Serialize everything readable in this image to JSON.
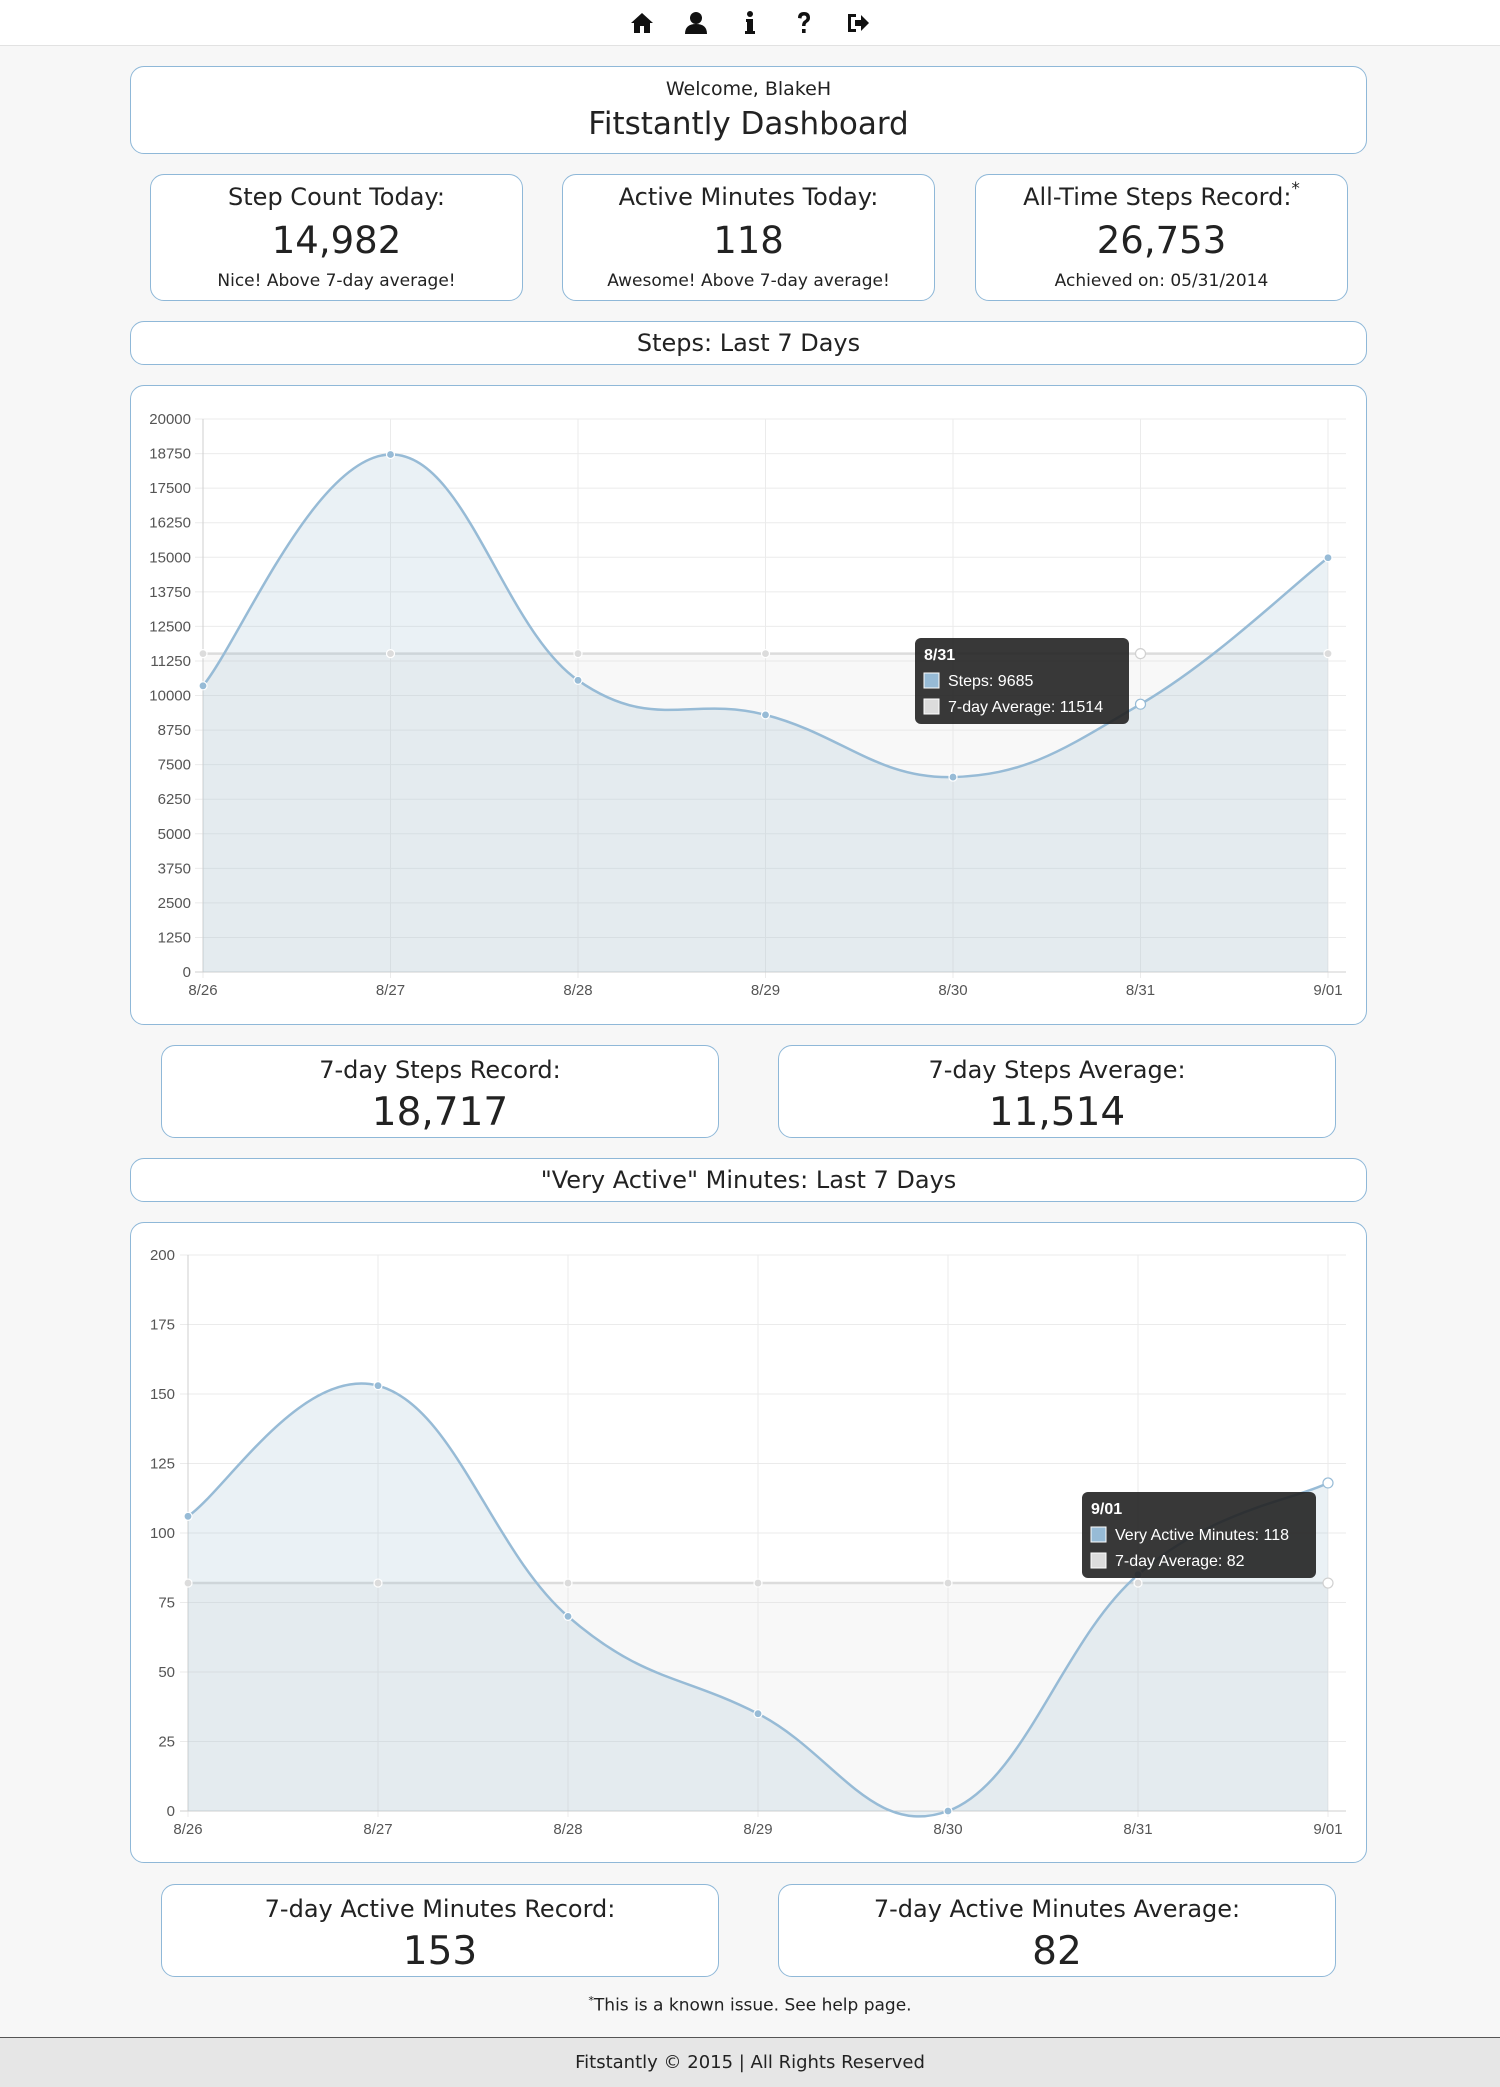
{
  "nav": {
    "icons": [
      "home-icon",
      "user-icon",
      "info-icon",
      "help-icon",
      "sign-out-icon"
    ]
  },
  "header": {
    "welcome": "Welcome, BlakeH",
    "title": "Fitstantly Dashboard"
  },
  "stats": {
    "steps_today": {
      "label": "Step Count Today:",
      "value": "14,982",
      "note": "Nice! Above 7-day average!"
    },
    "active_today": {
      "label": "Active Minutes Today:",
      "value": "118",
      "note": "Awesome! Above 7-day average!"
    },
    "all_time": {
      "label": "All-Time Steps Record:",
      "asterisk": "*",
      "value": "26,753",
      "note": "Achieved on: 05/31/2014"
    }
  },
  "steps_section": {
    "title": "Steps: Last 7 Days",
    "record_label": "7-day Steps Record:",
    "record_value": "18,717",
    "average_label": "7-day Steps Average:",
    "average_value": "11,514"
  },
  "minutes_section": {
    "title": "\"Very Active\" Minutes: Last 7 Days",
    "record_label": "7-day Active Minutes Record:",
    "record_value": "153",
    "average_label": "7-day Active Minutes Average:",
    "average_value": "82"
  },
  "footnote": {
    "mark": "*",
    "text": "This is a known issue. See help page."
  },
  "footer": {
    "text": "Fitstantly © 2015 | All Rights Reserved"
  },
  "colors": {
    "card_border": "#8fb8d8",
    "series_line": "#97bbd6",
    "series_fill": "rgba(151,187,205,0.2)",
    "average_line": "#dcdcdc",
    "tooltip_bg": "#222222"
  },
  "chart_data": [
    {
      "type": "line",
      "categories": [
        "8/26",
        "8/27",
        "8/28",
        "8/29",
        "8/30",
        "8/31",
        "9/01"
      ],
      "series": [
        {
          "name": "Steps",
          "values": [
            10350,
            18717,
            10550,
            9300,
            7050,
            9685,
            14982
          ]
        },
        {
          "name": "7-day Average",
          "values": [
            11514,
            11514,
            11514,
            11514,
            11514,
            11514,
            11514
          ]
        }
      ],
      "ylim": [
        0,
        20000
      ],
      "yticks": [
        0,
        1250,
        2500,
        3750,
        5000,
        6250,
        7500,
        8750,
        10000,
        11250,
        12500,
        13750,
        15000,
        16250,
        17500,
        18750,
        20000
      ],
      "grid": true,
      "tooltip": {
        "title": "8/31",
        "lines": [
          "Steps: 9685",
          "7-day Average: 11514"
        ]
      }
    },
    {
      "type": "line",
      "categories": [
        "8/26",
        "8/27",
        "8/28",
        "8/29",
        "8/30",
        "8/31",
        "9/01"
      ],
      "series": [
        {
          "name": "Very Active Minutes",
          "values": [
            106,
            153,
            70,
            35,
            0,
            85,
            118
          ]
        },
        {
          "name": "7-day Average",
          "values": [
            82,
            82,
            82,
            82,
            82,
            82,
            82
          ]
        }
      ],
      "ylim": [
        0,
        200
      ],
      "yticks": [
        0,
        25,
        50,
        75,
        100,
        125,
        150,
        175,
        200
      ],
      "grid": true,
      "tooltip": {
        "title": "9/01",
        "lines": [
          "Very Active Minutes: 118",
          "7-day Average: 82"
        ]
      }
    }
  ]
}
